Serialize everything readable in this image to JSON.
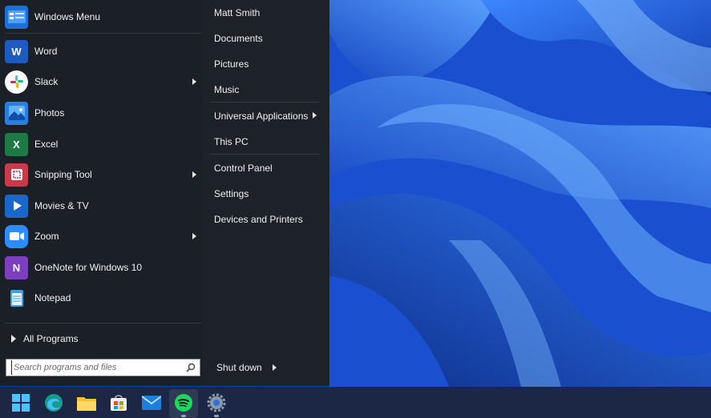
{
  "start_menu": {
    "apps": [
      {
        "label": "Windows Menu",
        "icon": "windows-menu-icon",
        "has_submenu": false
      },
      {
        "label": "Word",
        "icon": "word-icon",
        "has_submenu": false
      },
      {
        "label": "Slack",
        "icon": "slack-icon",
        "has_submenu": true
      },
      {
        "label": "Photos",
        "icon": "photos-icon",
        "has_submenu": false
      },
      {
        "label": "Excel",
        "icon": "excel-icon",
        "has_submenu": false
      },
      {
        "label": "Snipping Tool",
        "icon": "snipping-tool-icon",
        "has_submenu": true
      },
      {
        "label": "Movies & TV",
        "icon": "movies-tv-icon",
        "has_submenu": false
      },
      {
        "label": "Zoom",
        "icon": "zoom-icon",
        "has_submenu": true
      },
      {
        "label": "OneNote for Windows 10",
        "icon": "onenote-icon",
        "has_submenu": false
      },
      {
        "label": "Notepad",
        "icon": "notepad-icon",
        "has_submenu": false
      }
    ],
    "all_programs_label": "All Programs",
    "search": {
      "placeholder": "Search programs and files",
      "value": ""
    },
    "places": [
      {
        "label": "Matt Smith",
        "has_submenu": false
      },
      {
        "label": "Documents",
        "has_submenu": false
      },
      {
        "label": "Pictures",
        "has_submenu": false
      },
      {
        "label": "Music",
        "has_submenu": false
      },
      {
        "label": "Universal Applications",
        "has_submenu": true
      },
      {
        "label": "This PC",
        "has_submenu": false
      },
      {
        "label": "Control Panel",
        "has_submenu": false
      },
      {
        "label": "Settings",
        "has_submenu": false
      },
      {
        "label": "Devices and Printers",
        "has_submenu": false
      }
    ],
    "shutdown_label": "Shut down"
  },
  "taskbar": {
    "icons": [
      "windows-start-icon",
      "edge-icon",
      "file-explorer-icon",
      "microsoft-store-icon",
      "mail-icon",
      "spotify-icon",
      "settings-gear-icon"
    ]
  },
  "colors": {
    "menu_bg": "#1b2027",
    "taskbar_bg": "#1b2744",
    "wallpaper_accent": "#1e5ad8"
  }
}
